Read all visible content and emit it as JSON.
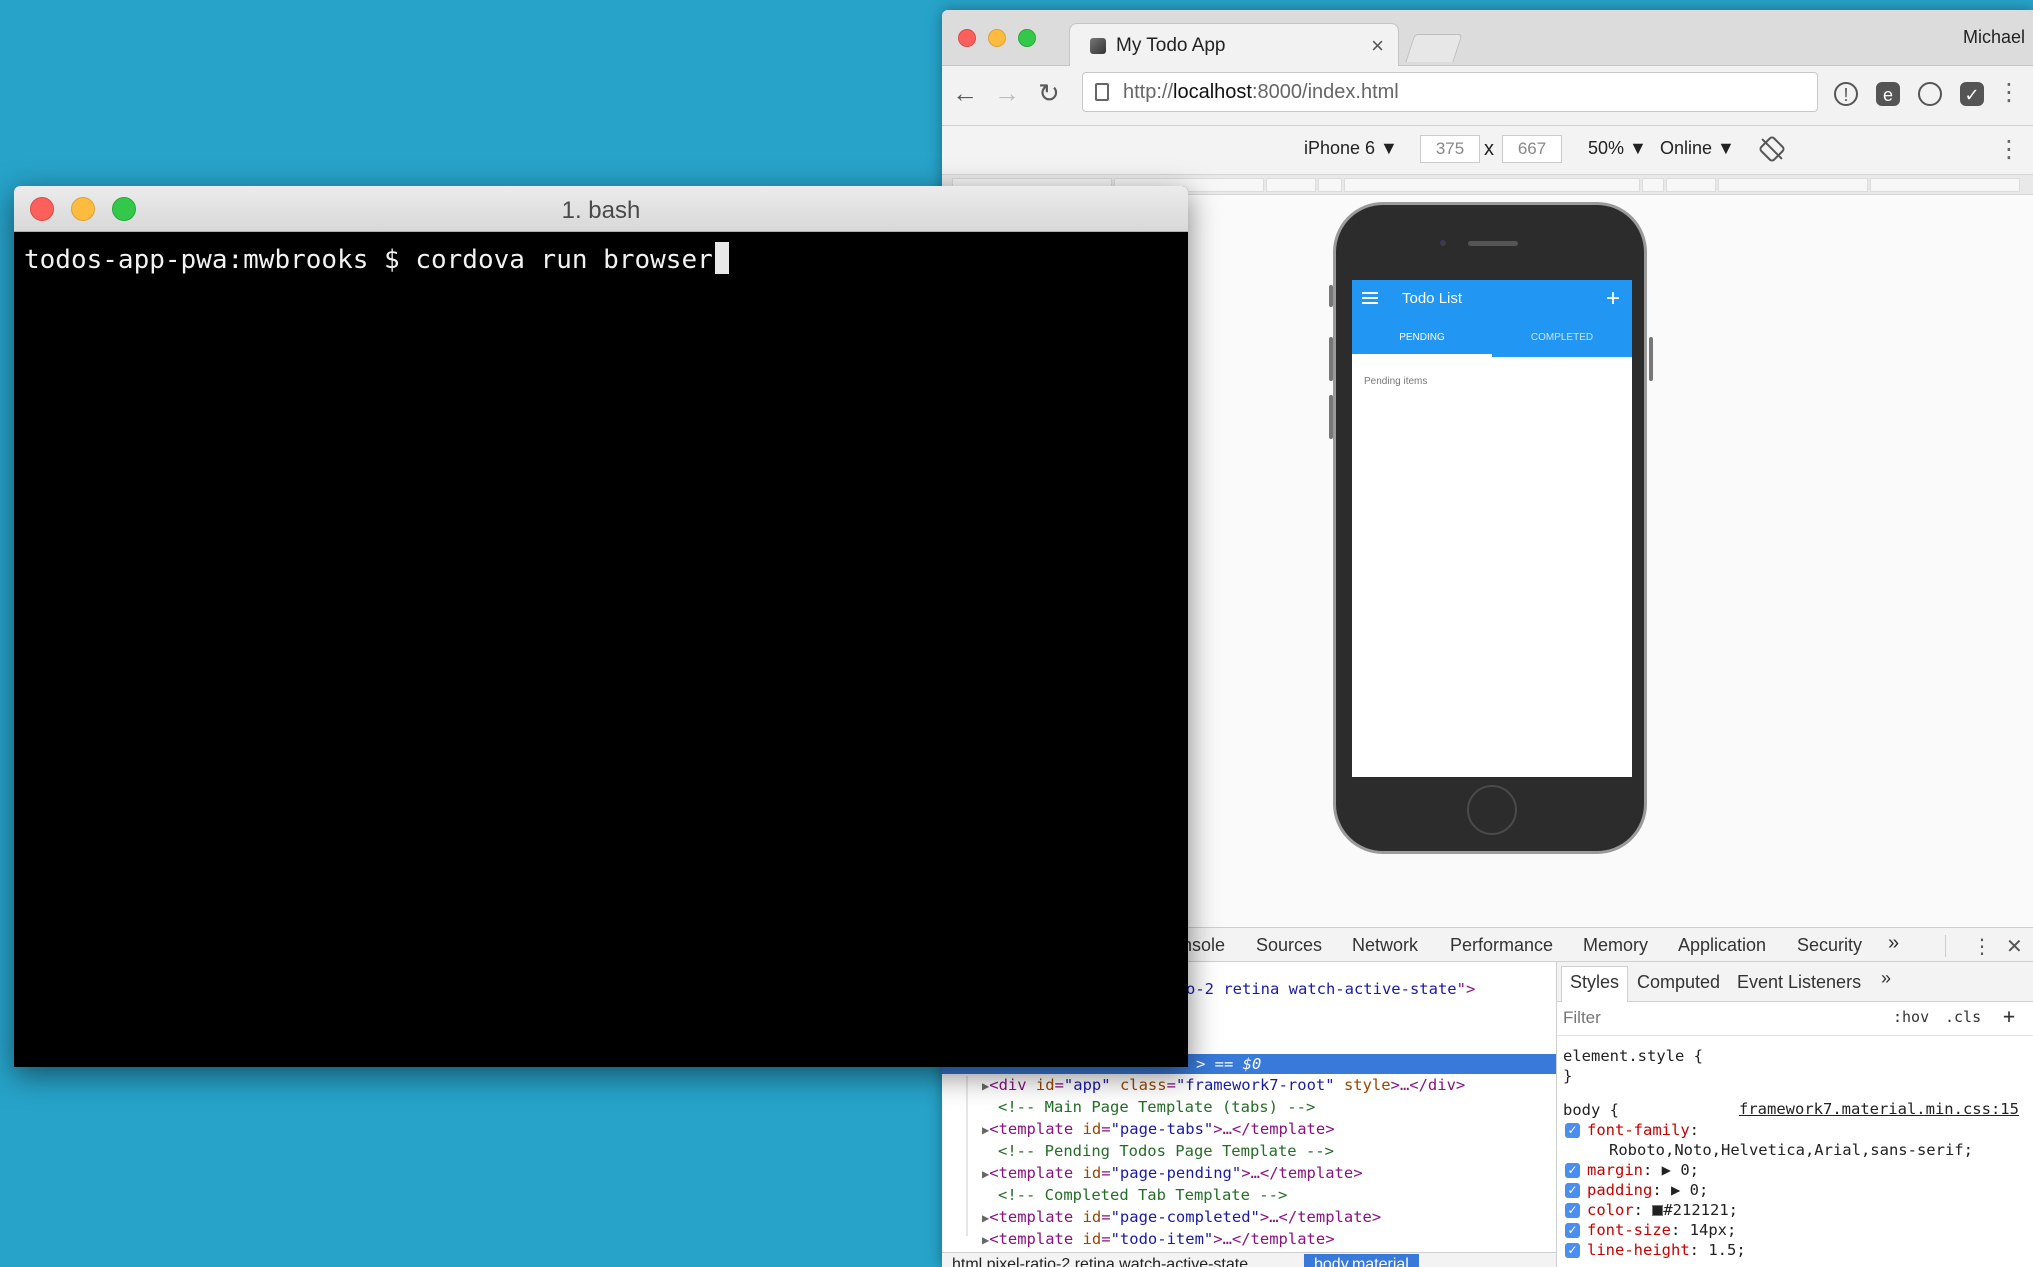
{
  "desktop": {
    "background_color": "#27a3c9"
  },
  "chrome": {
    "tab": {
      "title": "My Todo App"
    },
    "profile_name": "Michael",
    "address": {
      "scheme": "http://",
      "host": "localhost",
      "rest": ":8000/index.html"
    },
    "device_toolbar": {
      "device": "iPhone 6 ▼",
      "width": "375",
      "height": "667",
      "times": "x",
      "zoom": "50% ▼",
      "network": "Online ▼"
    },
    "app": {
      "title": "Todo List",
      "add": "+",
      "tabs": [
        "PENDING",
        "COMPLETED"
      ],
      "pending_text": "Pending items",
      "accent": "#2196f3"
    },
    "devtools": {
      "tabs": [
        "nsole",
        "Sources",
        "Network",
        "Performance",
        "Memory",
        "Application",
        "Security"
      ],
      "more": "»",
      "elements": {
        "line0": {
          "pre": "o-2 retina watch-active-state",
          "post": "\">"
        },
        "selected": "> == $0",
        "div": {
          "tag_open": "<div ",
          "a1": "id",
          "v1": "\"app\"",
          "a2": "class",
          "v2": "\"framework7-root\"",
          "a3": "style",
          "tail": ">…</div>"
        },
        "comment1": "<!-- Main Page Template (tabs) -->",
        "tpl1": {
          "id": "\"page-tabs\""
        },
        "comment2": "<!-- Pending Todos Page Template -->",
        "tpl2": {
          "id": "\"page-pending\""
        },
        "comment3": "<!-- Completed Tab Template -->",
        "tpl3": {
          "id": "\"page-completed\""
        },
        "tpl4": {
          "id": "\"todo-item\""
        },
        "template_open": "<template ",
        "id_attr": "id",
        "template_close": ">…</template>"
      },
      "breadcrumb": [
        "html.pixel-ratio-2.retina.watch-active-state",
        "body.material"
      ],
      "styles": {
        "tabs": [
          "Styles",
          "Computed",
          "Event Listeners"
        ],
        "more": "»",
        "filter_placeholder": "Filter",
        "hov": ":hov",
        "cls": ".cls",
        "add": "+",
        "element_style_open": "element.style {",
        "close_brace": "}",
        "body_selector": "body {",
        "source": "framework7.material.min.css:15",
        "props": [
          {
            "name": "font-family",
            "value": ""
          },
          {
            "name": "margin",
            "value": "▶ 0;"
          },
          {
            "name": "padding",
            "value": "▶ 0;"
          },
          {
            "name": "color",
            "value": "#212121;"
          },
          {
            "name": "font-size",
            "value": "14px;"
          },
          {
            "name": "line-height",
            "value": "1.5;"
          }
        ],
        "font_family_value": "Roboto,Noto,Helvetica,Arial,sans-serif;"
      }
    }
  },
  "terminal": {
    "title": "1. bash",
    "prompt": "todos-app-pwa:mwbrooks $ cordova run browser"
  }
}
